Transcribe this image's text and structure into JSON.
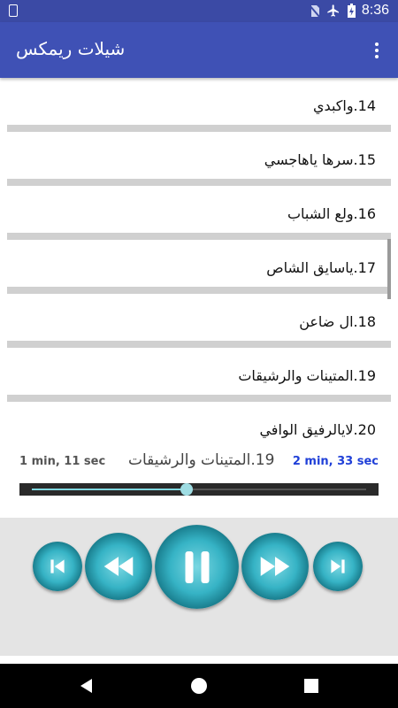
{
  "status_bar": {
    "time": "8:36"
  },
  "app_bar": {
    "title": "شيلات ريمكس"
  },
  "tracks": [
    {
      "label": "14.واكبدي"
    },
    {
      "label": "15.سرها ياهاجسي"
    },
    {
      "label": "16.ولع الشباب"
    },
    {
      "label": "17.ياسايق الشاص"
    },
    {
      "label": "18.ال ضاعن"
    },
    {
      "label": "19.المتينات والرشيقات"
    },
    {
      "label": "20.لايالرفيق الوافي"
    }
  ],
  "player": {
    "elapsed": "1 min, 11 sec",
    "duration": "2 min, 33 sec",
    "now_playing": "19.المتينات والرشيقات",
    "progress": 0.463
  },
  "controls": [
    "skip-previous-icon",
    "rewind-icon",
    "pause-icon",
    "fast-forward-icon",
    "skip-next-icon"
  ],
  "colors": {
    "app_bar": "#3f51b5",
    "status_bar": "#3b4aa5",
    "accent_time": "#2040d8",
    "button_teal": "#36b3c5"
  }
}
